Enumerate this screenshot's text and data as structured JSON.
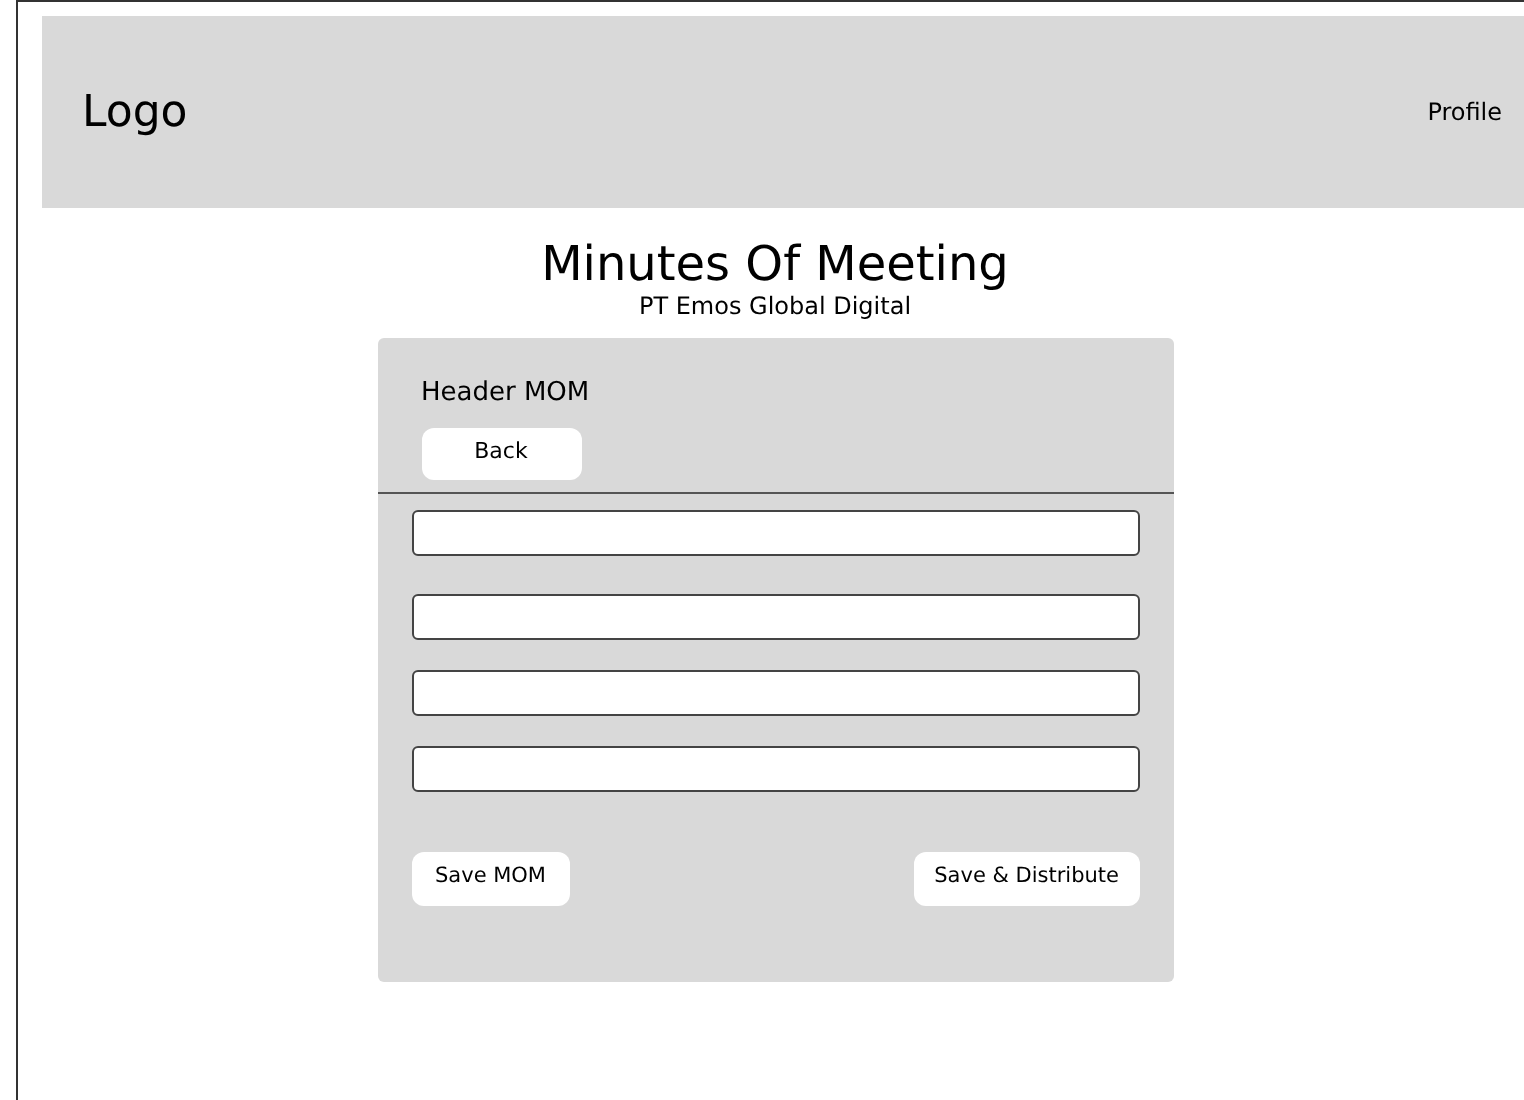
{
  "navbar": {
    "logo": "Logo",
    "profile": "Profile"
  },
  "page": {
    "title": "Minutes Of Meeting",
    "subtitle": "PT Emos Global Digital"
  },
  "form": {
    "header": "Header MOM",
    "back_button": "Back",
    "fields": [
      {
        "kind": "text"
      },
      {
        "kind": "text"
      },
      {
        "kind": "text"
      },
      {
        "kind": "text"
      }
    ],
    "buttons": [
      "Save MOM",
      "Save & Distribute"
    ]
  }
}
